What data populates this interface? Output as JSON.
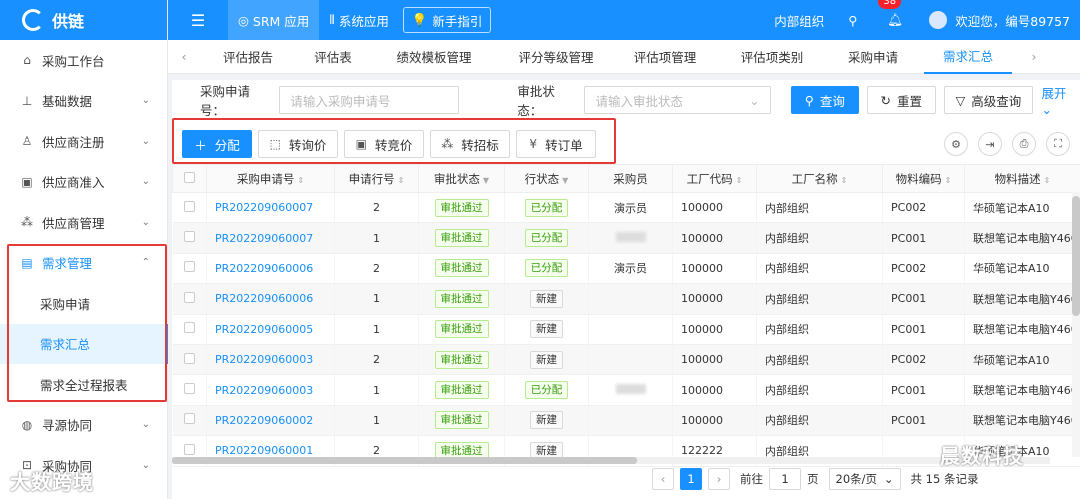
{
  "brand": {
    "name": "供链"
  },
  "topbar": {
    "srm_app": "SRM 应用",
    "sys_app": "系统应用",
    "guide": "新手指引",
    "org": "内部组织",
    "notif_count": "38",
    "welcome": "欢迎您，编号89757"
  },
  "sidebar": {
    "items": [
      {
        "label": "采购工作台",
        "icon": "home-icon"
      },
      {
        "label": "基础数据",
        "icon": "org-chart-icon"
      },
      {
        "label": "供应商注册",
        "icon": "user-icon"
      },
      {
        "label": "供应商准入",
        "icon": "id-card-icon"
      },
      {
        "label": "供应商管理",
        "icon": "network-icon"
      },
      {
        "label": "需求管理",
        "icon": "list-icon"
      },
      {
        "label": "采购申请"
      },
      {
        "label": "需求汇总"
      },
      {
        "label": "需求全过程报表"
      },
      {
        "label": "寻源协同",
        "icon": "globe-icon"
      },
      {
        "label": "采购协同",
        "icon": "cart-icon"
      }
    ]
  },
  "tabs": [
    "评估报告",
    "评估表",
    "绩效模板管理",
    "评分等级管理",
    "评估项管理",
    "评估项类别",
    "采购申请",
    "需求汇总"
  ],
  "filter": {
    "req_no_label": "采购申请号",
    "req_no_placeholder": "请输入采购申请号",
    "status_label": "审批状态",
    "status_placeholder": "请输入审批状态",
    "search": "查询",
    "reset": "重置",
    "advanced": "高级查询",
    "expand": "展开"
  },
  "toolbar": {
    "assign": "分配",
    "to_inquiry": "转询价",
    "to_bid": "转竞价",
    "to_tender": "转招标",
    "to_order": "转订单"
  },
  "table": {
    "headers": [
      "采购申请号",
      "申请行号",
      "审批状态",
      "行状态",
      "采购员",
      "工厂代码",
      "工厂名称",
      "物料编码",
      "物料描述"
    ],
    "rows": [
      [
        "PR202209060007",
        "2",
        "审批通过",
        "已分配",
        "演示员",
        "100000",
        "内部组织",
        "PC002",
        "华硕笔记本A10"
      ],
      [
        "PR202209060007",
        "1",
        "审批通过",
        "已分配",
        "",
        "100000",
        "内部组织",
        "PC001",
        "联想笔记本电脑Y460"
      ],
      [
        "PR202209060006",
        "2",
        "审批通过",
        "已分配",
        "演示员",
        "100000",
        "内部组织",
        "PC002",
        "华硕笔记本A10"
      ],
      [
        "PR202209060006",
        "1",
        "审批通过",
        "新建",
        "",
        "100000",
        "内部组织",
        "PC001",
        "联想笔记本电脑Y460"
      ],
      [
        "PR202209060005",
        "1",
        "审批通过",
        "新建",
        "",
        "100000",
        "内部组织",
        "PC001",
        "联想笔记本电脑Y460"
      ],
      [
        "PR202209060003",
        "2",
        "审批通过",
        "新建",
        "",
        "100000",
        "内部组织",
        "PC002",
        "华硕笔记本A10"
      ],
      [
        "PR202209060003",
        "1",
        "审批通过",
        "已分配",
        "",
        "100000",
        "内部组织",
        "PC001",
        "联想笔记本电脑Y460"
      ],
      [
        "PR202209060002",
        "1",
        "审批通过",
        "新建",
        "",
        "100000",
        "内部组织",
        "PC001",
        "联想笔记本电脑Y460"
      ],
      [
        "PR202209060001",
        "2",
        "审批通过",
        "新建",
        "",
        "122222",
        "内部组织",
        "",
        "华硕笔记本A10"
      ]
    ]
  },
  "pager": {
    "current": "1",
    "goto_label": "前往",
    "goto_value": "1",
    "page_unit": "页",
    "size": "20条/页",
    "total": "共 15 条记录"
  },
  "watermarks": {
    "left": "大数跨境",
    "right": "晨数科技"
  },
  "colors": {
    "primary": "#1890ff",
    "highlight": "#e53935"
  }
}
